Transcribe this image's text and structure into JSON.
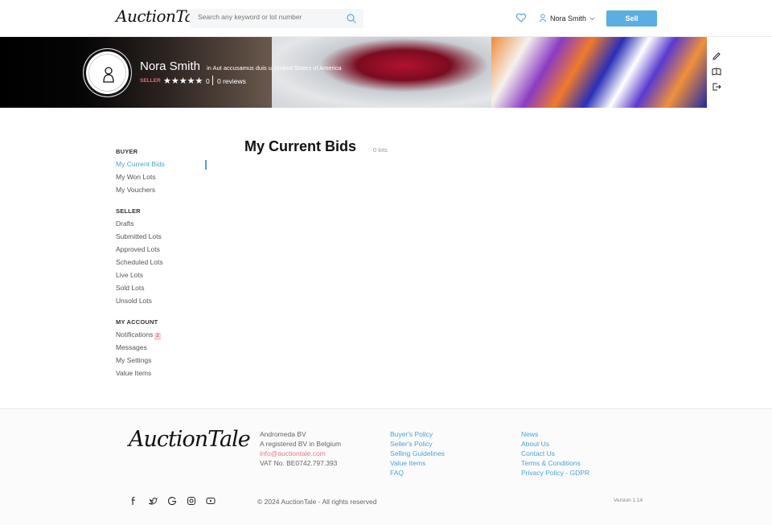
{
  "header": {
    "logo": "AuctionTale",
    "search_placeholder": "Search any keyword or lot number",
    "user_name": "Nora Smith",
    "sell_label": "Sell"
  },
  "profile": {
    "name": "Nora Smith",
    "location": "in Aut accusamus duis u, United States of America",
    "role": "SELLER",
    "stars": "★★★★★",
    "rating": "0",
    "reviews": "0 reviews"
  },
  "sidebar": {
    "buyer_title": "BUYER",
    "buyer_items": [
      "My Current Bids",
      "My Won Lots",
      "My Vouchers"
    ],
    "seller_title": "SELLER",
    "seller_items": [
      "Drafts",
      "Submitted Lots",
      "Approved Lots",
      "Scheduled Lots",
      "Live Lots",
      "Sold Lots",
      "Unsold Lots"
    ],
    "account_title": "MY ACCOUNT",
    "account_items": [
      "Notifications",
      "Messages",
      "My Settings",
      "Value Items"
    ],
    "notifications_badge": "2"
  },
  "main": {
    "title": "My Current Bids",
    "count": "0 lots"
  },
  "footer": {
    "logo": "AuctionTale",
    "company": [
      "Andromeda BV",
      "A registered BV in Belgium",
      "info@auctiontale.com",
      "VAT No. BE0742.797.393"
    ],
    "links1": [
      "Buyer's Policy",
      "Seller's Policy",
      "Selling Guidelines",
      "Value Items",
      "FAQ"
    ],
    "links2": [
      "News",
      "About Us",
      "Contact Us",
      "Terms & Conditions",
      "Privacy Policy - GDPR"
    ],
    "copyright": "© 2024 AuctionTale - All rights reserved",
    "version": "Version 1.14"
  },
  "colors": {
    "accent": "#4aa3d9",
    "sell_button": "#5aaee2",
    "seller_tag": "#e66b7e"
  }
}
